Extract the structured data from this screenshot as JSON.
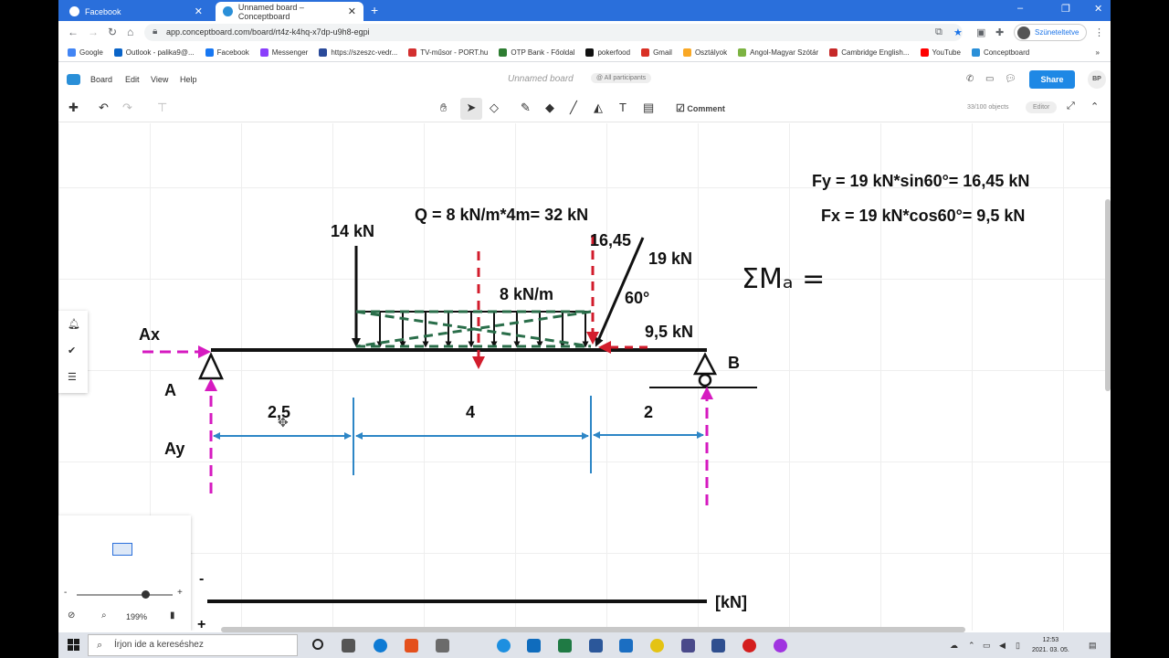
{
  "browser": {
    "tabs": [
      {
        "title": "Facebook",
        "favicon_color": "#1877f2"
      },
      {
        "title": "Unnamed board – Conceptboard",
        "favicon_color": "#2a8fd8"
      }
    ],
    "new_tab_symbol": "+",
    "window_controls": [
      "–",
      "❐",
      "✕"
    ],
    "url": "app.conceptboard.com/board/rt4z-k4hq-x7dp-u9h8-egpi",
    "profile_label": "Szüneteltetve",
    "bookmarks": [
      {
        "label": "Google",
        "color": "#4285f4"
      },
      {
        "label": "Outlook - palika9@...",
        "color": "#0a64c8"
      },
      {
        "label": "Facebook",
        "color": "#1877f2"
      },
      {
        "label": "Messenger",
        "color": "#8a3ffc"
      },
      {
        "label": "https://szeszc-vedr...",
        "color": "#2a4a9a"
      },
      {
        "label": "TV-műsor - PORT.hu",
        "color": "#d32f2f"
      },
      {
        "label": "OTP Bank - Főoldal",
        "color": "#2e7d32"
      },
      {
        "label": "pokerfood",
        "color": "#111111"
      },
      {
        "label": "Gmail",
        "color": "#d93025"
      },
      {
        "label": "Osztályok",
        "color": "#f9a825"
      },
      {
        "label": "Angol-Magyar Szótár",
        "color": "#7cb342"
      },
      {
        "label": "Cambridge English...",
        "color": "#c62828"
      },
      {
        "label": "YouTube",
        "color": "#ff0000"
      },
      {
        "label": "Conceptboard",
        "color": "#2a8fd8"
      }
    ],
    "bookmarks_more": "»"
  },
  "app": {
    "menu": [
      "Board",
      "Edit",
      "View",
      "Help"
    ],
    "board_title": "Unnamed board",
    "participants": "@ All participants",
    "share_label": "Share",
    "user_initials": "BP",
    "comment_label": "Comment",
    "objects_count": "33/100 objects",
    "role_badge": "Editor",
    "zoom_level": "199%",
    "minimap_minus": "-",
    "minimap_plus": "+"
  },
  "board": {
    "formula_fy": "Fy = 19 kN*sin60°= 16,45 kN",
    "formula_fx": "Fx = 19 kN*cos60°= 9,5 kN",
    "formula_q": "Q = 8 kN/m*4m= 32 kN",
    "load_point": "14 kN",
    "load_dist": "8 kN/m",
    "load_incline": "19 kN",
    "load_incline_vertical": "16,45",
    "load_incline_horizontal": "9,5 kN",
    "angle": "60°",
    "reaction_ax": "Ax",
    "reaction_ay": "Ay",
    "support_a": "A",
    "support_b": "B",
    "dim_1": "2,5",
    "dim_2": "4",
    "dim_3": "2",
    "moment_eq": "ΣMₐ =",
    "diagram_minus": "-",
    "diagram_plus": "+",
    "diagram_unit": "[kN]"
  },
  "taskbar": {
    "search_placeholder": "Írjon ide a kereséshez",
    "time": "12:53",
    "date": "2021. 03. 05."
  }
}
